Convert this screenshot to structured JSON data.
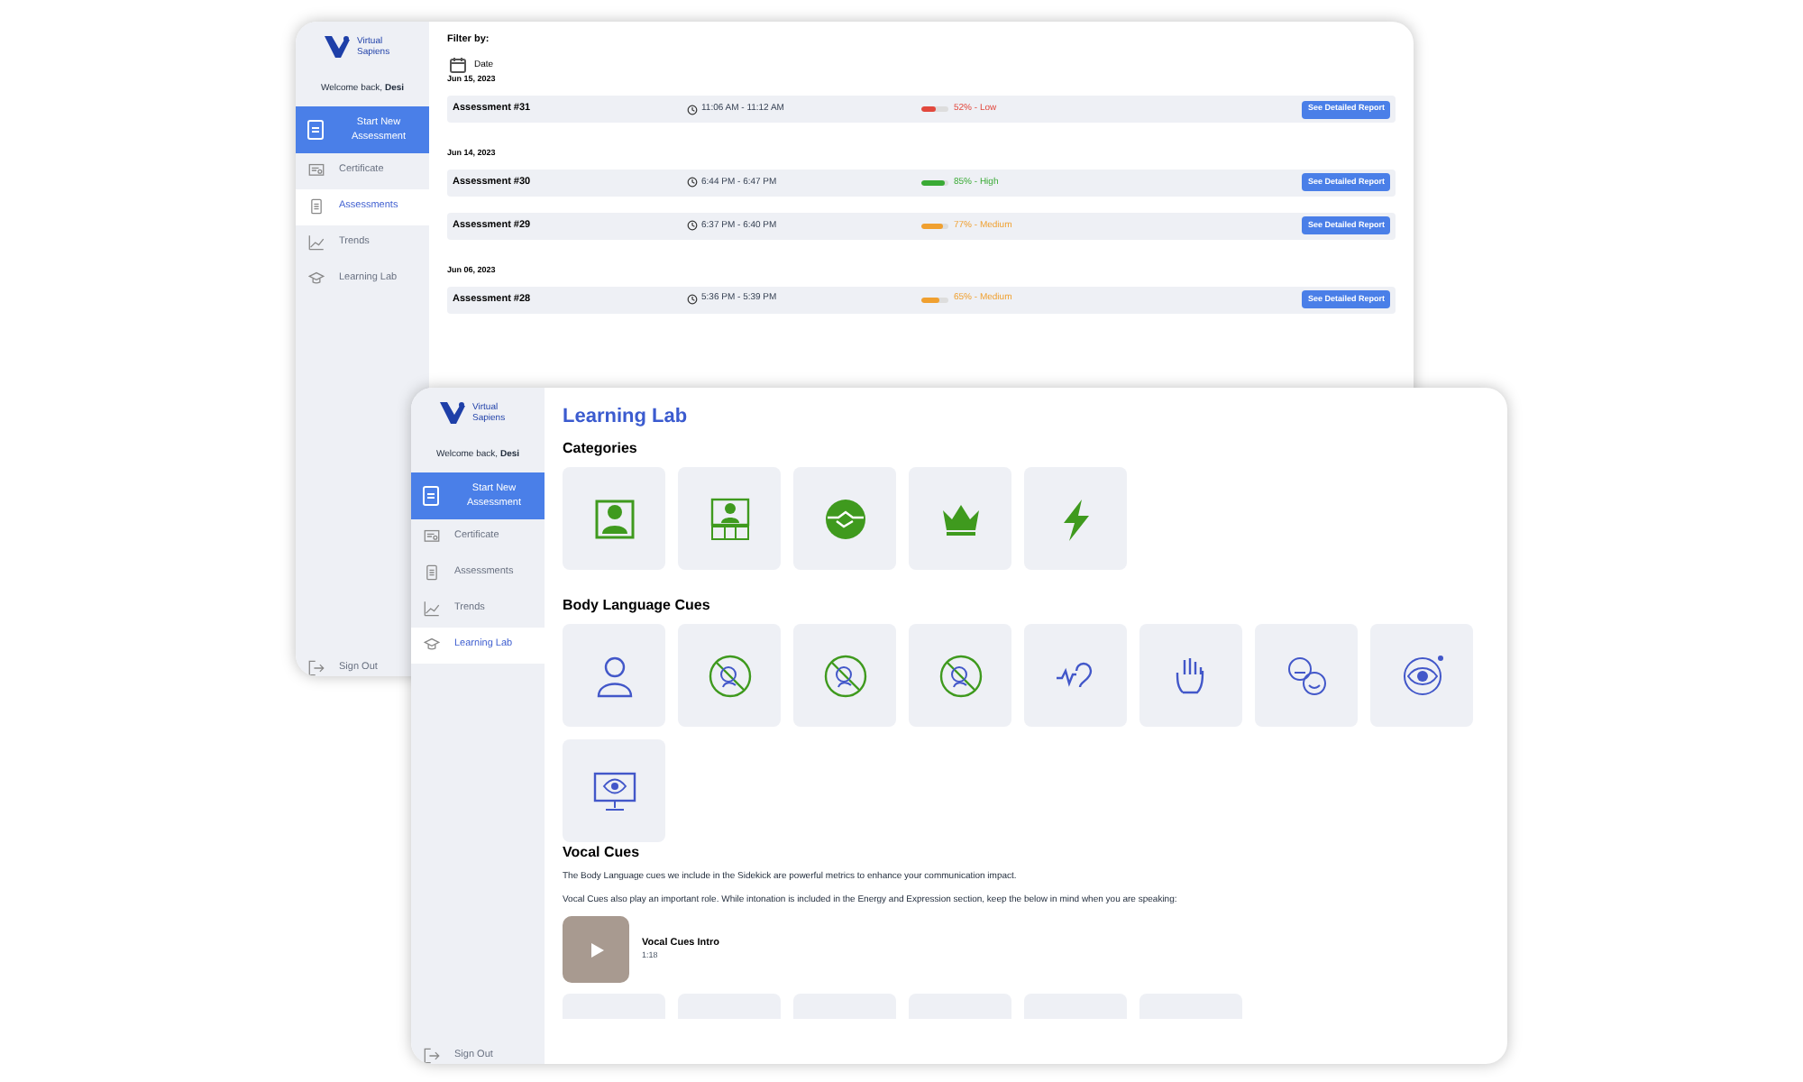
{
  "back_window": {
    "sidebar": {
      "logo": "Virtual Sapiens",
      "welcome": "Welcome back, **Desi**",
      "start_button": "Start New Assessment",
      "nav": [
        {
          "kind": "certificate",
          "label": "Certificate",
          "selected": false
        },
        {
          "kind": "assessments",
          "label": "Assessments",
          "selected": true
        },
        {
          "kind": "trends",
          "label": "Trends",
          "selected": false
        },
        {
          "kind": "learning_lab",
          "label": "Learning Lab",
          "selected": false
        }
      ],
      "sign_out": "Sign Out"
    },
    "filter_label": "Filter by:",
    "filter": "Date",
    "groups": [
      {
        "date": "Jun 15, 2023",
        "rows": [
          {
            "title": "Assessment #31",
            "time": "11:06 AM - 11:12 AM",
            "level": 0.52,
            "score": "52% - Low",
            "color": "#e2483d",
            "button": "See Detailed Report"
          }
        ]
      },
      {
        "date": "Jun 14, 2023",
        "rows": [
          {
            "title": "Assessment #30",
            "time": "6:44 PM - 6:47 PM",
            "level": 0.85,
            "score": "85% - High",
            "color": "#3aaa35",
            "button": "See Detailed Report"
          },
          {
            "title": "Assessment #29",
            "time": "6:37 PM - 6:40 PM",
            "level": 0.77,
            "score": "77% - Medium",
            "color": "#f0a030",
            "button": "See Detailed Report"
          }
        ]
      },
      {
        "date": "Jun 06, 2023",
        "rows": [
          {
            "title": "Assessment #28",
            "time": "5:36 PM - 5:39 PM",
            "level": 0.65,
            "score": "65% - Medium",
            "color": "#f0a030",
            "button": "See Detailed Report"
          }
        ]
      }
    ]
  },
  "front_window": {
    "sidebar": {
      "logo": "Virtual Sapiens",
      "welcome": "Welcome back, **Desi**",
      "start_button": "Start New Assessment",
      "nav": [
        {
          "kind": "certificate",
          "label": "Certificate",
          "selected": false
        },
        {
          "kind": "assessments",
          "label": "Assessments",
          "selected": false
        },
        {
          "kind": "trends",
          "label": "Trends",
          "selected": false
        },
        {
          "kind": "learning_lab",
          "label": "Learning Lab",
          "selected": true
        }
      ],
      "sign_out": "Sign Out"
    },
    "title": "Learning Lab",
    "sections": [
      {
        "heading": "Categories",
        "tiles": [
          {
            "kind": "presenter"
          },
          {
            "kind": "group_call"
          },
          {
            "kind": "handshake"
          },
          {
            "kind": "crown"
          },
          {
            "kind": "lightning"
          }
        ]
      },
      {
        "heading": "Body Language Cues",
        "tiles": [
          {
            "kind": "person"
          },
          {
            "kind": "no_touch"
          },
          {
            "kind": "no_touch"
          },
          {
            "kind": "no_touch"
          },
          {
            "kind": "ear"
          },
          {
            "kind": "hand"
          },
          {
            "kind": "faces"
          },
          {
            "kind": "eye"
          },
          {
            "kind": "monitor_eye"
          }
        ]
      },
      {
        "heading": "Vocal Cues",
        "paragraphs": [
          "The Body Language cues we include in the Sidekick are powerful metrics to enhance your communication impact.",
          "Vocal Cues also play an important role. While intonation is included in the Energy and Expression section, keep the below in mind when you are speaking:"
        ],
        "video": {
          "title": "Vocal Cues Intro",
          "duration": "1:18"
        },
        "tiles": [
          {
            "kind": "blank"
          },
          {
            "kind": "blank"
          },
          {
            "kind": "blank"
          },
          {
            "kind": "blank"
          },
          {
            "kind": "blank"
          },
          {
            "kind": "blank"
          }
        ]
      }
    ]
  }
}
